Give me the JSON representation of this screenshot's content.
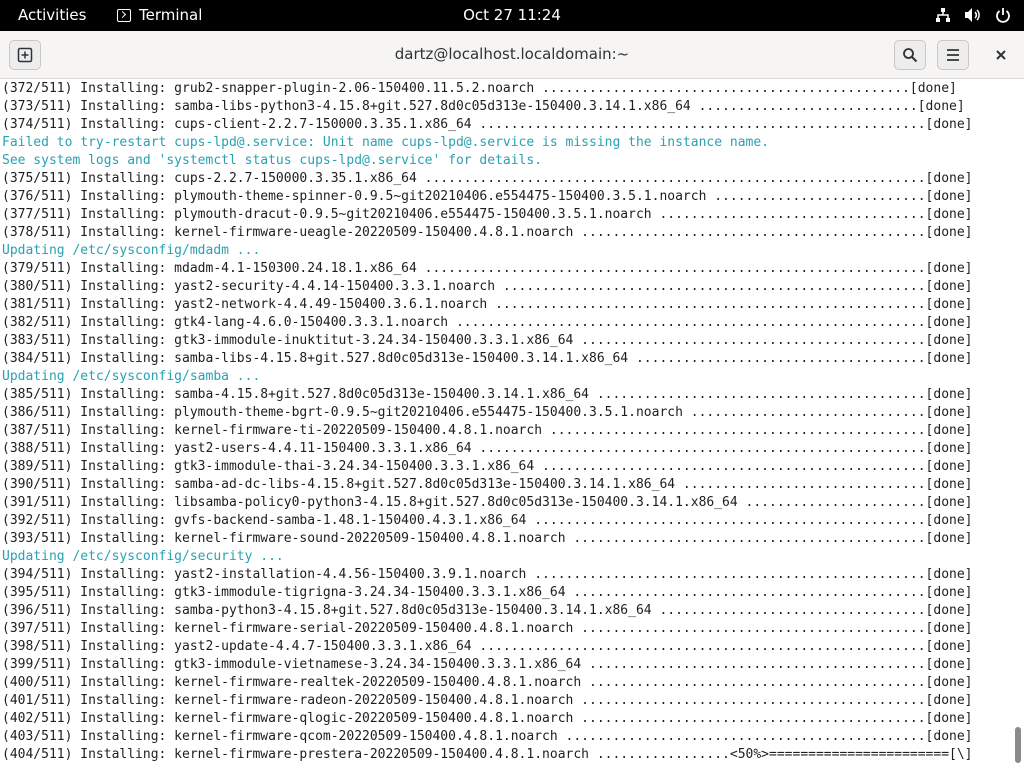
{
  "topbar": {
    "activities": "Activities",
    "app_name": "Terminal",
    "clock": "Oct 27  11:24"
  },
  "window": {
    "title": "dartz@localhost.localdomain:~"
  },
  "lines": [
    {
      "text": "(372/511) Installing: grub2-snapper-plugin-2.06-150400.11.5.2.noarch ...............................................[done]",
      "type": "normal"
    },
    {
      "text": "(373/511) Installing: samba-libs-python3-4.15.8+git.527.8d0c05d313e-150400.3.14.1.x86_64 ............................[done]",
      "type": "normal"
    },
    {
      "text": "(374/511) Installing: cups-client-2.2.7-150000.3.35.1.x86_64 .........................................................[done]",
      "type": "normal"
    },
    {
      "text": "Failed to try-restart cups-lpd@.service: Unit name cups-lpd@.service is missing the instance name.",
      "type": "cyan"
    },
    {
      "text": "See system logs and 'systemctl status cups-lpd@.service' for details.",
      "type": "cyan"
    },
    {
      "text": "(375/511) Installing: cups-2.2.7-150000.3.35.1.x86_64 ................................................................[done]",
      "type": "normal"
    },
    {
      "text": "(376/511) Installing: plymouth-theme-spinner-0.9.5~git20210406.e554475-150400.3.5.1.noarch ...........................[done]",
      "type": "normal"
    },
    {
      "text": "(377/511) Installing: plymouth-dracut-0.9.5~git20210406.e554475-150400.3.5.1.noarch ..................................[done]",
      "type": "normal"
    },
    {
      "text": "(378/511) Installing: kernel-firmware-ueagle-20220509-150400.4.8.1.noarch ............................................[done]",
      "type": "normal"
    },
    {
      "text": "Updating /etc/sysconfig/mdadm ...",
      "type": "cyan"
    },
    {
      "text": "(379/511) Installing: mdadm-4.1-150300.24.18.1.x86_64 ................................................................[done]",
      "type": "normal"
    },
    {
      "text": "(380/511) Installing: yast2-security-4.4.14-150400.3.3.1.noarch ......................................................[done]",
      "type": "normal"
    },
    {
      "text": "(381/511) Installing: yast2-network-4.4.49-150400.3.6.1.noarch .......................................................[done]",
      "type": "normal"
    },
    {
      "text": "(382/511) Installing: gtk4-lang-4.6.0-150400.3.3.1.noarch ............................................................[done]",
      "type": "normal"
    },
    {
      "text": "(383/511) Installing: gtk3-immodule-inuktitut-3.24.34-150400.3.3.1.x86_64 ............................................[done]",
      "type": "normal"
    },
    {
      "text": "(384/511) Installing: samba-libs-4.15.8+git.527.8d0c05d313e-150400.3.14.1.x86_64 .....................................[done]",
      "type": "normal"
    },
    {
      "text": "Updating /etc/sysconfig/samba ...",
      "type": "cyan"
    },
    {
      "text": "(385/511) Installing: samba-4.15.8+git.527.8d0c05d313e-150400.3.14.1.x86_64 ..........................................[done]",
      "type": "normal"
    },
    {
      "text": "(386/511) Installing: plymouth-theme-bgrt-0.9.5~git20210406.e554475-150400.3.5.1.noarch ..............................[done]",
      "type": "normal"
    },
    {
      "text": "(387/511) Installing: kernel-firmware-ti-20220509-150400.4.8.1.noarch ................................................[done]",
      "type": "normal"
    },
    {
      "text": "(388/511) Installing: yast2-users-4.4.11-150400.3.3.1.x86_64 .........................................................[done]",
      "type": "normal"
    },
    {
      "text": "(389/511) Installing: gtk3-immodule-thai-3.24.34-150400.3.3.1.x86_64 .................................................[done]",
      "type": "normal"
    },
    {
      "text": "(390/511) Installing: samba-ad-dc-libs-4.15.8+git.527.8d0c05d313e-150400.3.14.1.x86_64 ...............................[done]",
      "type": "normal"
    },
    {
      "text": "(391/511) Installing: libsamba-policy0-python3-4.15.8+git.527.8d0c05d313e-150400.3.14.1.x86_64 .......................[done]",
      "type": "normal"
    },
    {
      "text": "(392/511) Installing: gvfs-backend-samba-1.48.1-150400.4.3.1.x86_64 ..................................................[done]",
      "type": "normal"
    },
    {
      "text": "(393/511) Installing: kernel-firmware-sound-20220509-150400.4.8.1.noarch .............................................[done]",
      "type": "normal"
    },
    {
      "text": "Updating /etc/sysconfig/security ...",
      "type": "cyan"
    },
    {
      "text": "(394/511) Installing: yast2-installation-4.4.56-150400.3.9.1.noarch ..................................................[done]",
      "type": "normal"
    },
    {
      "text": "(395/511) Installing: gtk3-immodule-tigrigna-3.24.34-150400.3.3.1.x86_64 .............................................[done]",
      "type": "normal"
    },
    {
      "text": "(396/511) Installing: samba-python3-4.15.8+git.527.8d0c05d313e-150400.3.14.1.x86_64 ..................................[done]",
      "type": "normal"
    },
    {
      "text": "(397/511) Installing: kernel-firmware-serial-20220509-150400.4.8.1.noarch ............................................[done]",
      "type": "normal"
    },
    {
      "text": "(398/511) Installing: yast2-update-4.4.7-150400.3.3.1.x86_64 .........................................................[done]",
      "type": "normal"
    },
    {
      "text": "(399/511) Installing: gtk3-immodule-vietnamese-3.24.34-150400.3.3.1.x86_64 ...........................................[done]",
      "type": "normal"
    },
    {
      "text": "(400/511) Installing: kernel-firmware-realtek-20220509-150400.4.8.1.noarch ...........................................[done]",
      "type": "normal"
    },
    {
      "text": "(401/511) Installing: kernel-firmware-radeon-20220509-150400.4.8.1.noarch ............................................[done]",
      "type": "normal"
    },
    {
      "text": "(402/511) Installing: kernel-firmware-qlogic-20220509-150400.4.8.1.noarch ............................................[done]",
      "type": "normal"
    },
    {
      "text": "(403/511) Installing: kernel-firmware-qcom-20220509-150400.4.8.1.noarch ..............................................[done]",
      "type": "normal"
    },
    {
      "text": "(404/511) Installing: kernel-firmware-prestera-20220509-150400.4.8.1.noarch .................<50%>=======================[\\]",
      "type": "normal"
    }
  ]
}
